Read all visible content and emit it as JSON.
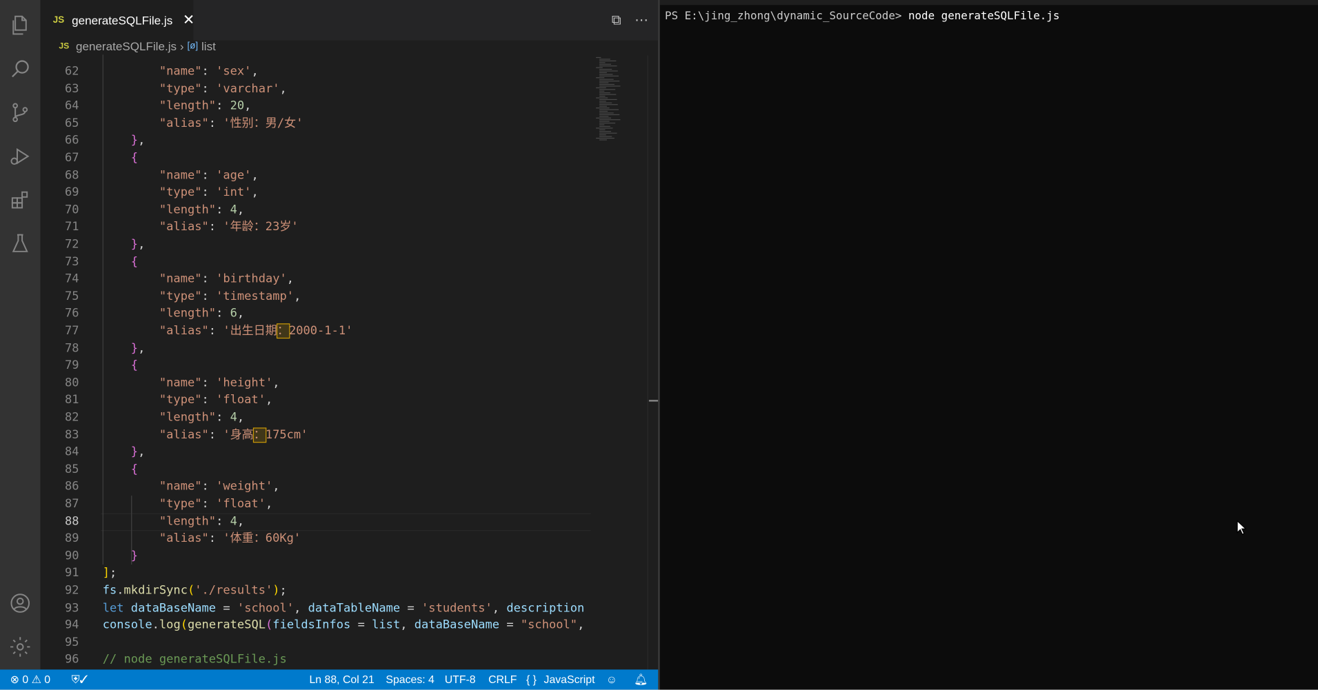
{
  "editor": {
    "tab": {
      "badge": "JS",
      "filename": "generateSQLFile.js",
      "close": "✕"
    },
    "actions": {
      "split": "⧉",
      "more": "⋯"
    },
    "breadcrumb": {
      "badge": "JS",
      "file": "generateSQLFile.js",
      "sep": "›",
      "symbol_icon": "[ø]",
      "symbol": "list"
    },
    "lines": [
      {
        "n": "62",
        "html": "        <span class='k'>\"name\"</span>: <span class='s'>'sex'</span>,"
      },
      {
        "n": "63",
        "html": "        <span class='k'>\"type\"</span>: <span class='s'>'varchar'</span>,"
      },
      {
        "n": "64",
        "html": "        <span class='k'>\"length\"</span>: <span class='n'>20</span>,"
      },
      {
        "n": "65",
        "html": "        <span class='k'>\"alias\"</span>: <span class='s'>'性别：男/女'</span>"
      },
      {
        "n": "66",
        "html": "    <span class='br2'>}</span>,"
      },
      {
        "n": "67",
        "html": "    <span class='br2'>{</span>"
      },
      {
        "n": "68",
        "html": "        <span class='k'>\"name\"</span>: <span class='s'>'age'</span>,"
      },
      {
        "n": "69",
        "html": "        <span class='k'>\"type\"</span>: <span class='s'>'int'</span>,"
      },
      {
        "n": "70",
        "html": "        <span class='k'>\"length\"</span>: <span class='n'>4</span>,"
      },
      {
        "n": "71",
        "html": "        <span class='k'>\"alias\"</span>: <span class='s'>'年龄：23岁'</span>"
      },
      {
        "n": "72",
        "html": "    <span class='br2'>}</span>,"
      },
      {
        "n": "73",
        "html": "    <span class='br2'>{</span>"
      },
      {
        "n": "74",
        "html": "        <span class='k'>\"name\"</span>: <span class='s'>'birthday'</span>,"
      },
      {
        "n": "75",
        "html": "        <span class='k'>\"type\"</span>: <span class='s'>'timestamp'</span>,"
      },
      {
        "n": "76",
        "html": "        <span class='k'>\"length\"</span>: <span class='n'>6</span>,"
      },
      {
        "n": "77",
        "html": "        <span class='k'>\"alias\"</span>: <span class='s'>'出生日期<span class=\"hl\">：</span>2000-1-1'</span>"
      },
      {
        "n": "78",
        "html": "    <span class='br2'>}</span>,"
      },
      {
        "n": "79",
        "html": "    <span class='br2'>{</span>"
      },
      {
        "n": "80",
        "html": "        <span class='k'>\"name\"</span>: <span class='s'>'height'</span>,"
      },
      {
        "n": "81",
        "html": "        <span class='k'>\"type\"</span>: <span class='s'>'float'</span>,"
      },
      {
        "n": "82",
        "html": "        <span class='k'>\"length\"</span>: <span class='n'>4</span>,"
      },
      {
        "n": "83",
        "html": "        <span class='k'>\"alias\"</span>: <span class='s'>'身高<span class=\"hl\">：</span>175cm'</span>"
      },
      {
        "n": "84",
        "html": "    <span class='br2'>}</span>,"
      },
      {
        "n": "85",
        "html": "    <span class='br2'>{</span>"
      },
      {
        "n": "86",
        "html": "        <span class='k'>\"name\"</span>: <span class='s'>'weight'</span>,"
      },
      {
        "n": "87",
        "html": "        <span class='k'>\"type\"</span>: <span class='s'>'float'</span>,"
      },
      {
        "n": "88",
        "html": "        <span class='k'>\"length\"</span>: <span class='n'>4</span>,"
      },
      {
        "n": "89",
        "html": "        <span class='k'>\"alias\"</span>: <span class='s'>'体重：60Kg'</span>"
      },
      {
        "n": "90",
        "html": "    <span class='br2'>}</span>"
      },
      {
        "n": "91",
        "html": "<span class='br1'>]</span>;"
      },
      {
        "n": "92",
        "html": "<span class='var'>fs</span>.<span class='fn'>mkdirSync</span><span class='br1'>(</span><span class='s'>'./results'</span><span class='br1'>)</span>;"
      },
      {
        "n": "93",
        "html": "<span class='kw'>let</span> <span class='var'>dataBaseName</span> = <span class='s'>'school'</span>, <span class='var'>dataTableName</span> = <span class='s'>'students'</span>, <span class='var'>description</span> ="
      },
      {
        "n": "94",
        "html": "<span class='var'>console</span>.<span class='fn'>log</span><span class='br1'>(</span><span class='fn'>generateSQL</span><span class='br2'>(</span><span class='var'>fieldsInfos</span> = <span class='var'>list</span>, <span class='var'>dataBaseName</span> = <span class='s'>\"school\"</span>, <span class='var'>d</span>"
      },
      {
        "n": "95",
        "html": ""
      },
      {
        "n": "96",
        "html": "<span class='c'>// node generateSQLFile.js</span>"
      }
    ],
    "active_line": "88"
  },
  "statusbar": {
    "errors": "0",
    "warnings": "0",
    "shield": "⛨✓",
    "position": "Ln 88, Col 21",
    "spaces": "Spaces: 4",
    "encoding": "UTF-8",
    "eol": "CRLF",
    "language_icon": "{ }",
    "language": "JavaScript"
  },
  "terminal": {
    "prompt": "PS E:\\jing_zhong\\dynamic_SourceCode> ",
    "command": "node generateSQLFile.js"
  },
  "colors": {
    "accent": "#007acc",
    "activity": "#333333",
    "editor_bg": "#1e1e1e",
    "terminal_bg": "#0c0c0c"
  }
}
